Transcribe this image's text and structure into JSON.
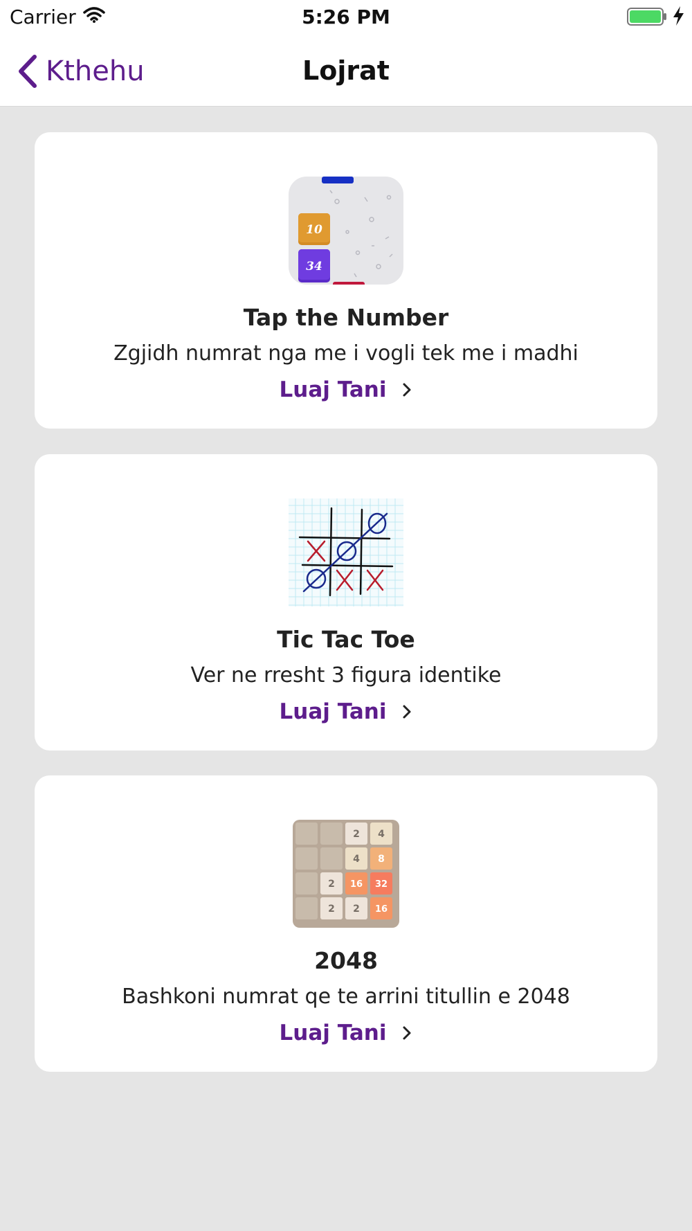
{
  "status_bar": {
    "carrier": "Carrier",
    "time": "5:26 PM",
    "battery_color": "#4cd964"
  },
  "nav": {
    "back_label": "Kthehu",
    "title": "Lojrat",
    "accent_color": "#5d1d8c"
  },
  "games": [
    {
      "title": "Tap the Number",
      "description": "Zgjidh numrat nga me i vogli tek me i madhi",
      "action_label": "Luaj Tani",
      "thumb_icon": "number-tiles-icon",
      "thumb_tiles": [
        "10",
        "34"
      ]
    },
    {
      "title": "Tic Tac Toe",
      "description": "Ver ne rresht 3 figura identike",
      "action_label": "Luaj Tani",
      "thumb_icon": "tic-tac-toe-icon"
    },
    {
      "title": "2048",
      "description": "Bashkoni numrat qe te arrini titullin e 2048",
      "action_label": "Luaj Tani",
      "thumb_icon": "2048-board-icon",
      "board": [
        [
          "",
          "",
          "2",
          "4"
        ],
        [
          "",
          "",
          "4",
          "8"
        ],
        [
          "",
          "2",
          "16",
          "32"
        ],
        [
          "",
          "2",
          "2",
          "16"
        ]
      ]
    }
  ]
}
